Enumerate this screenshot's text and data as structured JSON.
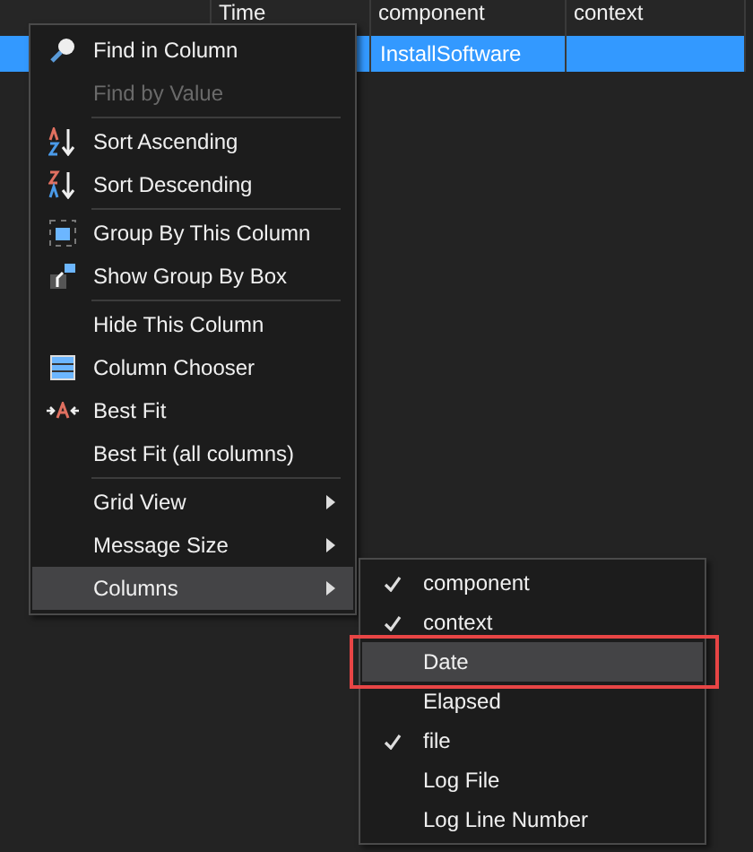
{
  "grid": {
    "columns": [
      {},
      {
        "label": "Time"
      },
      {
        "label": "component"
      },
      {
        "label": "context"
      }
    ],
    "rows": [
      {
        "selected": true,
        "cells": [
          "",
          "",
          "InstallSoftware",
          ""
        ]
      }
    ]
  },
  "context_menu": {
    "items": [
      {
        "kind": "item",
        "label": "Find in Column",
        "disabled": false
      },
      {
        "kind": "item",
        "label": "Find by Value",
        "disabled": true
      },
      {
        "kind": "separator"
      },
      {
        "kind": "item",
        "label": "Sort Ascending",
        "disabled": false
      },
      {
        "kind": "item",
        "label": "Sort Descending",
        "disabled": false
      },
      {
        "kind": "separator"
      },
      {
        "kind": "item",
        "label": "Group By This Column",
        "disabled": false
      },
      {
        "kind": "item",
        "label": "Show Group By Box",
        "disabled": false
      },
      {
        "kind": "separator"
      },
      {
        "kind": "item",
        "label": "Hide This Column",
        "disabled": false
      },
      {
        "kind": "item",
        "label": "Column Chooser",
        "disabled": false
      },
      {
        "kind": "item",
        "label": "Best Fit",
        "disabled": false
      },
      {
        "kind": "item",
        "label": "Best Fit (all columns)",
        "disabled": false
      },
      {
        "kind": "separator"
      },
      {
        "kind": "submenu",
        "label": "Grid View",
        "selected": false
      },
      {
        "kind": "submenu",
        "label": "Message Size",
        "selected": false
      },
      {
        "kind": "submenu",
        "label": "Columns",
        "selected": true
      }
    ]
  },
  "columns_submenu": {
    "items": [
      {
        "label": "component",
        "checked": true,
        "selected": false,
        "outlined": false
      },
      {
        "label": "context",
        "checked": true,
        "selected": false,
        "outlined": false
      },
      {
        "label": "Date",
        "checked": false,
        "selected": true,
        "outlined": true
      },
      {
        "label": "Elapsed",
        "checked": false,
        "selected": false,
        "outlined": false
      },
      {
        "label": "file",
        "checked": true,
        "selected": false,
        "outlined": false
      },
      {
        "label": "Log File",
        "checked": false,
        "selected": false,
        "outlined": false
      },
      {
        "label": "Log Line Number",
        "checked": false,
        "selected": false,
        "outlined": false
      }
    ]
  }
}
